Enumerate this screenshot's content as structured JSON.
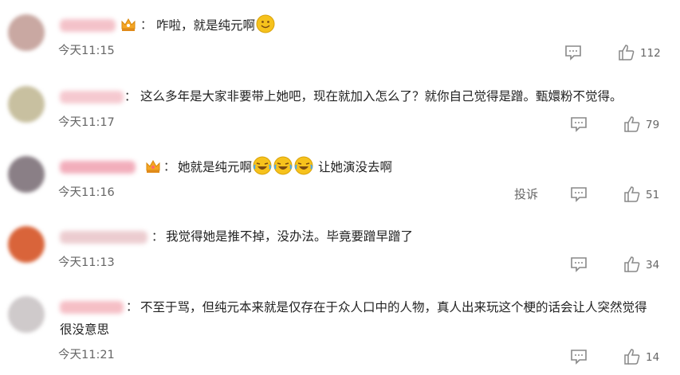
{
  "comments": [
    {
      "text": "咋啦，就是纯元啊",
      "time": "今天11:15",
      "likes": "112",
      "colon": "：",
      "emoji_after": "smile-emoji",
      "avatar_color": "#c9a8a2",
      "name_color": "#f2b8c0"
    },
    {
      "text": "这么多年是大家非要带上她吧，现在就加入怎么了？就你自己觉得是蹭。甄嬛粉不觉得。",
      "time": "今天11:17",
      "likes": "79",
      "colon": "：",
      "avatar_color": "#c8c0a0",
      "name_color": "#f4c0c8"
    },
    {
      "text": "她就是纯元啊",
      "text_after": " 让她演没去啊",
      "time": "今天11:16",
      "likes": "51",
      "colon": "：",
      "report": "投诉",
      "emoji_after": "laugh-cry-emoji",
      "avatar_color": "#8a7f86",
      "name_color": "#f0a0b0"
    },
    {
      "text": "我觉得她是推不掉，没办法。毕竟要蹭早蹭了",
      "time": "今天11:13",
      "likes": "34",
      "colon": "：",
      "avatar_color": "#d9643a",
      "name_color": "#e9c4c8"
    },
    {
      "text": "不至于骂，但纯元本来就是仅存在于众人口中的人物，真人出来玩这个梗的话会让人突然觉得很没意思",
      "time": "今天11:21",
      "likes": "14",
      "colon": "：",
      "avatar_color": "#cfcacb",
      "name_color": "#f4b4bc"
    }
  ],
  "icons": {
    "reply": "comment-reply-icon",
    "like": "thumbs-up-icon",
    "badge": "crown-badge-icon"
  },
  "colors": {
    "emoji": "#f6c21c",
    "icon": "#888888"
  }
}
